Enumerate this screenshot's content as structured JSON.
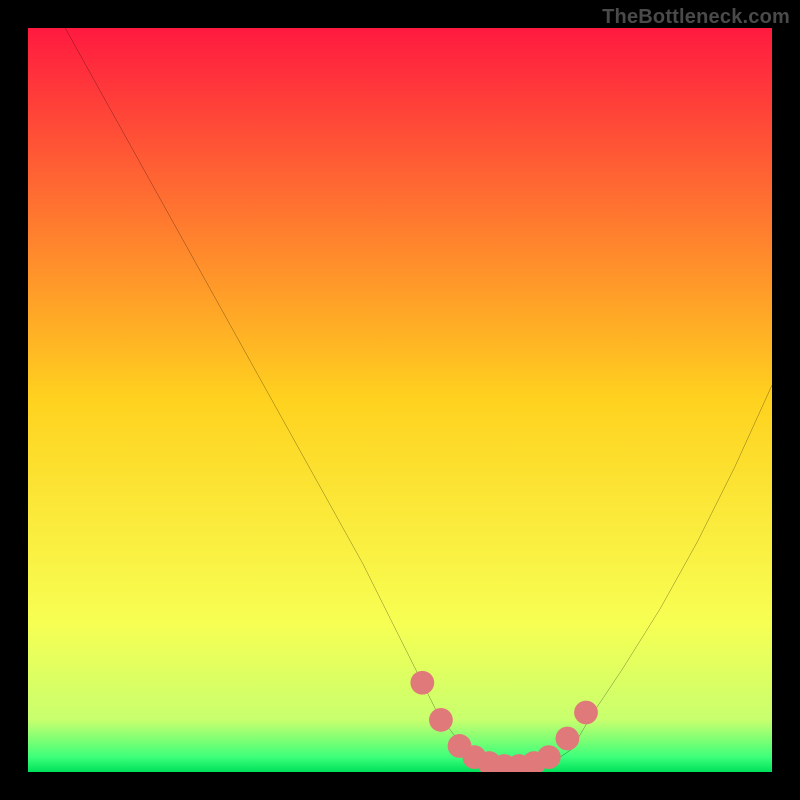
{
  "watermark": "TheBottleneck.com",
  "chart_data": {
    "type": "line",
    "title": "",
    "xlabel": "",
    "ylabel": "",
    "xlim": [
      0,
      100
    ],
    "ylim": [
      0,
      100
    ],
    "grid": false,
    "legend": false,
    "background_gradient": {
      "stops": [
        {
          "offset": 0.0,
          "color": "#ff1a40"
        },
        {
          "offset": 0.5,
          "color": "#ffd21f"
        },
        {
          "offset": 0.8,
          "color": "#f7ff53"
        },
        {
          "offset": 0.93,
          "color": "#c8ff6e"
        },
        {
          "offset": 0.98,
          "color": "#3dff7a"
        },
        {
          "offset": 1.0,
          "color": "#00e05b"
        }
      ]
    },
    "series": [
      {
        "name": "bottleneck-curve",
        "x": [
          5,
          10,
          15,
          20,
          25,
          30,
          35,
          40,
          45,
          50,
          53,
          55,
          58,
          60,
          62,
          65,
          68,
          70,
          73,
          76,
          80,
          85,
          90,
          95,
          100
        ],
        "y": [
          100,
          91,
          82,
          73,
          64,
          55,
          46,
          37,
          28,
          18,
          12,
          8,
          4,
          2,
          1,
          0.5,
          0.5,
          1,
          3,
          8,
          14,
          22,
          31,
          41,
          52
        ]
      }
    ],
    "highlight": {
      "name": "min-region-dots",
      "x": [
        53,
        55.5,
        58,
        60,
        62,
        64,
        66,
        68,
        70,
        72.5,
        75
      ],
      "y": [
        12,
        7,
        3.5,
        2,
        1.2,
        0.8,
        0.8,
        1.2,
        2,
        4.5,
        8
      ],
      "color": "#e07a7a",
      "radius": 1.6
    }
  }
}
